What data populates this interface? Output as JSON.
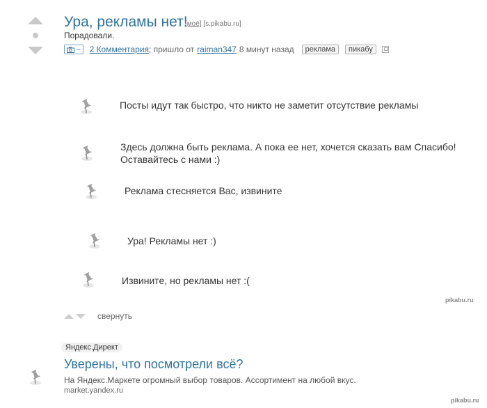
{
  "post": {
    "title": "Ура, рекламы нет!",
    "mine_label": "[моё]",
    "source_label": "[s.pikabu.ru]",
    "subtitle": "Порадовали.",
    "camera_minus": "–",
    "comments_link": "2 Комментария",
    "posted_from": "; пришло от",
    "author": "raiman347",
    "time_ago": "8 минут назад",
    "tags": [
      "реклама",
      "пикабу"
    ]
  },
  "messages": [
    {
      "text": "Посты идут так быстро, что никто не заметит отсутствие рекламы"
    },
    {
      "text": "Здесь должна быть реклама. А пока ее нет, хочется сказать вам Спасибо! Оставайтесь с нами :)"
    },
    {
      "text": "Реклама стесняется Вас, извините"
    },
    {
      "text": "Ура! Рекламы нет :)"
    },
    {
      "text": "Извините, но рекламы нет :("
    }
  ],
  "collapse_label": "свернуть",
  "watermark": "pikabu.ru",
  "ad": {
    "badge": "Яндекс.Директ",
    "title": "Уверены, что посмотрели всё?",
    "description": "На Яндекс.Маркете огромный выбор товаров. Ассортимент на любой вкус.",
    "url": "market.yandex.ru"
  },
  "colors": {
    "link": "#31739e",
    "vote_arrows": "#c9c9c9"
  }
}
